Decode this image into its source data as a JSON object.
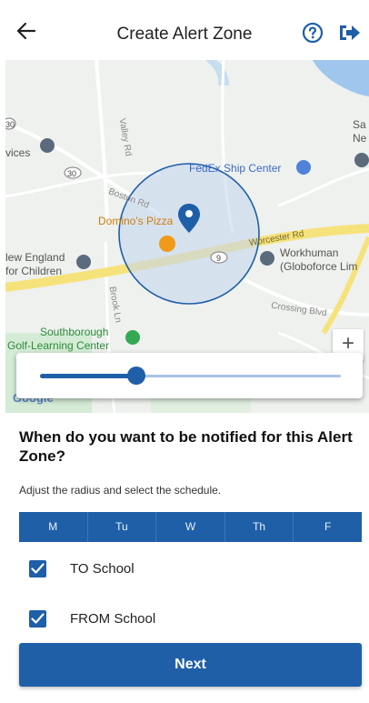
{
  "header": {
    "title": "Create Alert Zone",
    "colors": {
      "icon": "#1f5fa8",
      "text": "#222222"
    }
  },
  "map": {
    "labels": {
      "services": "vices",
      "fedex": "FedEx Ship Center",
      "dominos": "Domino's Pizza",
      "new_england_1": "lew England",
      "new_england_2": "for Children",
      "workhuman_1": "Workhuman",
      "workhuman_2": "(Globoforce Lim",
      "southborough_1": "Southborough",
      "southborough_2": "Golf-Learning Center",
      "sa": "Sa",
      "ne": "Ne",
      "valley_rd": "Valley Rd",
      "boston_rd": "Boston Rd",
      "worcester_rd": "Worcester Rd",
      "crossing_blvd": "Crossing Blvd",
      "brook_ln": "Brook Ln",
      "route_30": "30",
      "route_9": "9",
      "route_30_left": "30"
    },
    "zoom_in_label": "+",
    "google": "Google",
    "colors": {
      "zone_fill": "#c7d7ee",
      "zone_stroke": "#1f5fa8",
      "road": "#f6e27a"
    }
  },
  "slider": {
    "value": 0.32
  },
  "content": {
    "question": "When do you want to be notified for this Alert Zone?",
    "subtitle": "Adjust the radius and select the schedule.",
    "days": [
      "M",
      "Tu",
      "W",
      "Th",
      "F"
    ],
    "options": [
      {
        "label": "TO School",
        "checked": true
      },
      {
        "label": "FROM School",
        "checked": true
      }
    ],
    "next_label": "Next"
  },
  "theme": {
    "primary": "#1f5fa8"
  }
}
